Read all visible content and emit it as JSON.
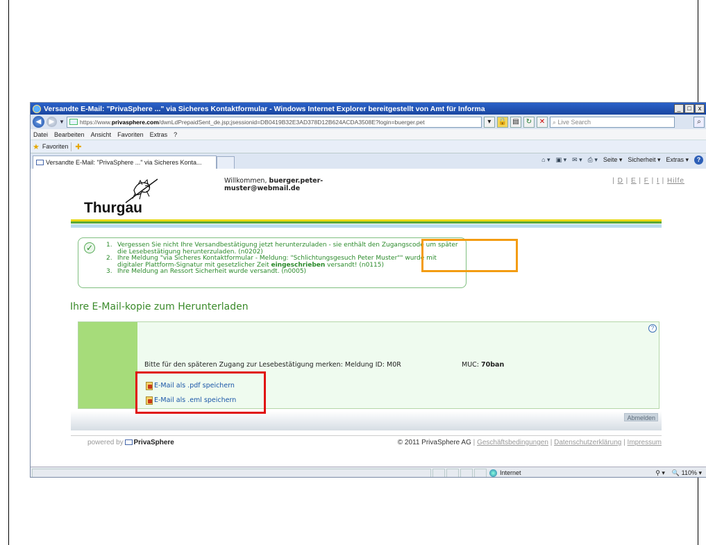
{
  "window": {
    "title": "Versandte E-Mail: \"PrivaSphere ...\" via Sicheres Kontaktformular - Windows Internet Explorer bereitgestellt von Amt für Informa",
    "min": "_",
    "max": "□",
    "close": "x"
  },
  "address": {
    "scheme": "https://www.",
    "host": "privasphere.com",
    "path": "/dwnLdPrepaidSent_de.jsp;jsessionid=DB0419B32E3AD378D12B624ACDA3508E?login=buerger.pet",
    "search_placeholder": "Live Search"
  },
  "menu": [
    "Datei",
    "Bearbeiten",
    "Ansicht",
    "Favoriten",
    "Extras",
    "?"
  ],
  "favorites": {
    "label": "Favoriten"
  },
  "tab": {
    "label": "Versandte E-Mail: \"PrivaSphere ...\" via Sicheres Konta..."
  },
  "commandbar": {
    "page": "Seite ▾",
    "safety": "Sicherheit ▾",
    "extras": "Extras ▾"
  },
  "page": {
    "logo_text": "Thurgau",
    "welcome_prefix": "Willkommen,",
    "welcome_user_line1": "buerger.peter-",
    "welcome_user_line2": "muster@webmail.de",
    "lang": [
      "D",
      "E",
      "F",
      "I"
    ],
    "help_link": "Hilfe",
    "messages": [
      {
        "num": "1.",
        "text": "Vergessen Sie nicht Ihre Versandbestätigung jetzt herunterzuladen - sie enthält den Zugangscode um später die Lesebestätigung herunterzuladen. (n0202)"
      },
      {
        "num": "2.",
        "pre": "Ihre Meldung \"via Sicheres Kontaktformular - Meldung: \"Schlichtungsgesuch Peter Muster\"\" wurde mit digitaler Plattform-Signatur mit gesetzlicher Zeit ",
        "bold": "eingeschrieben",
        "post": " versandt! (n0115)"
      },
      {
        "num": "3.",
        "text": "Ihre Meldung an Ressort Sicherheit wurde versandt. (n0005)"
      }
    ],
    "section_title": "Ihre E-Mail-kopie zum Herunterladen",
    "help_icon": "?",
    "remember_note": "Bitte für den späteren Zugang zur Lesebestätigung merken:   Meldung ID: M0R",
    "muc_label": "MUC:",
    "muc_value": "70ban",
    "link_pdf": "E-Mail als .pdf speichern",
    "link_eml": "E-Mail als .eml speichern",
    "logout": "Abmelden",
    "powered_by": "powered by",
    "powered_brand": "PrivaSphere",
    "copyright": "© 2011 PrivaSphere AG",
    "footer_links": [
      "Geschäftsbedingungen",
      "Datenschutzerklärung",
      "Impressum"
    ]
  },
  "status": {
    "zone": "Internet",
    "zoom": "110%"
  },
  "colors": {
    "accent_green": "#3a8a2a",
    "panel_green": "#a6dc7a",
    "highlight_orange": "#f39c12",
    "highlight_red": "#e01010"
  }
}
